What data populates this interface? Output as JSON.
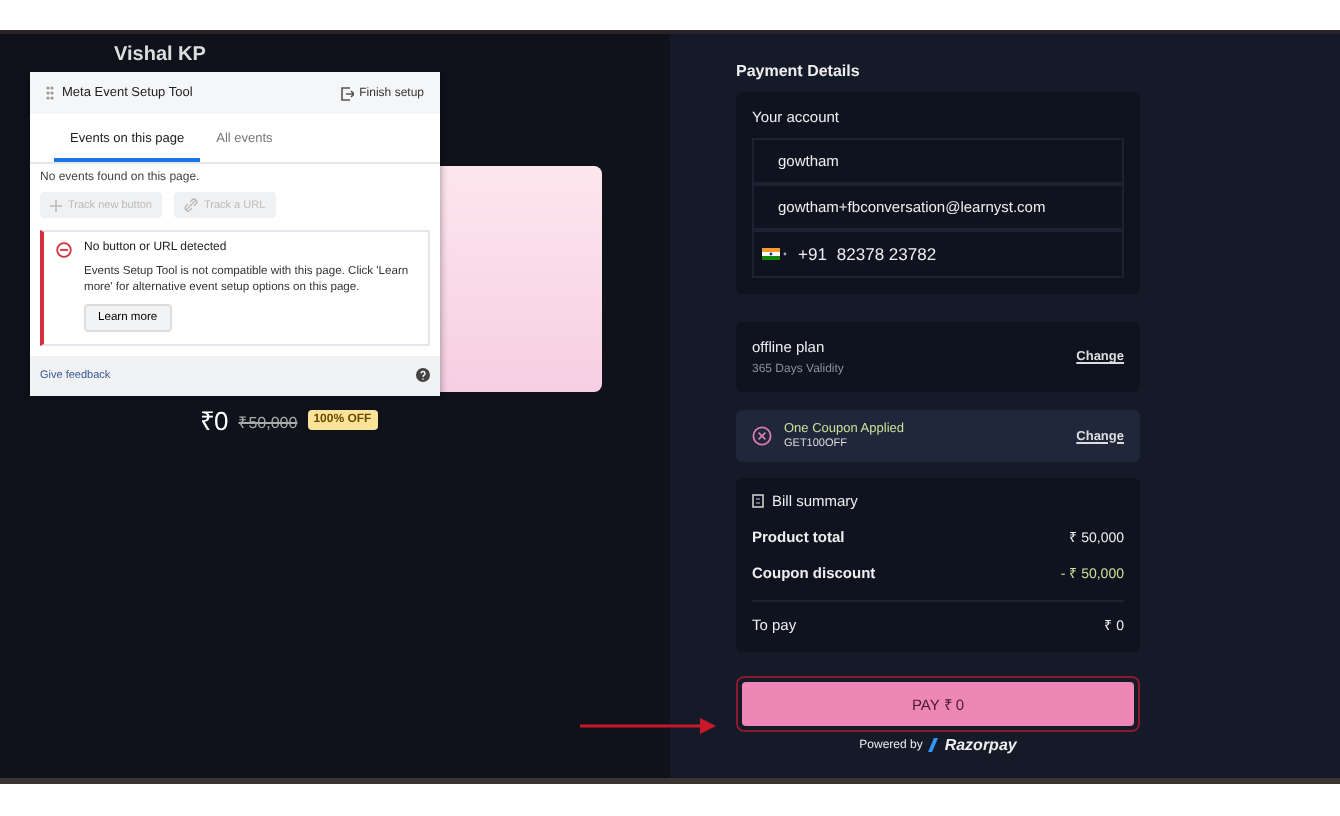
{
  "header": {
    "user_name": "Vishal KP"
  },
  "course": {
    "price": "₹0",
    "original_price": "₹50,000",
    "discount_badge": "100% OFF"
  },
  "setup_tool": {
    "title": "Meta Event Setup Tool",
    "finish_button": "Finish setup",
    "tabs": [
      {
        "label": "Events on this page",
        "selected": true
      },
      {
        "label": "All events",
        "selected": false
      }
    ],
    "empty_message": "No events found on this page.",
    "actions": [
      {
        "label": "Track new button",
        "kind": "plus",
        "disabled": true
      },
      {
        "label": "Track a URL",
        "kind": "link",
        "disabled": true
      }
    ],
    "alert": {
      "title": "No button or URL detected",
      "message": "Events Setup Tool is not compatible with this page. Click 'Learn more' for alternative event setup options on this page.",
      "button": "Learn more"
    },
    "feedback_link": "Give feedback"
  },
  "payment": {
    "heading": "Payment Details",
    "account": {
      "label": "Your account",
      "name": "gowtham",
      "email": "gowtham+fbconversation@learnyst.com",
      "country_code": "+91",
      "phone": "82378 23782"
    },
    "plan": {
      "name": "offline plan",
      "validity": "365 Days Validity",
      "change_link": "Change"
    },
    "coupon": {
      "title": "One Coupon Applied",
      "code": "GET100OFF",
      "change_link": "Change"
    },
    "bill": {
      "title": "Bill summary",
      "rows": [
        {
          "label": "Product total",
          "value": "₹ 50,000",
          "kind": "plain"
        },
        {
          "label": "Coupon discount",
          "value": "- ₹ 50,000",
          "kind": "discount"
        },
        {
          "label": "To pay",
          "value": "₹ 0",
          "kind": "total"
        }
      ]
    },
    "pay_button": "PAY ₹ 0",
    "powered_by": "Powered by",
    "brand": "Razorpay"
  }
}
